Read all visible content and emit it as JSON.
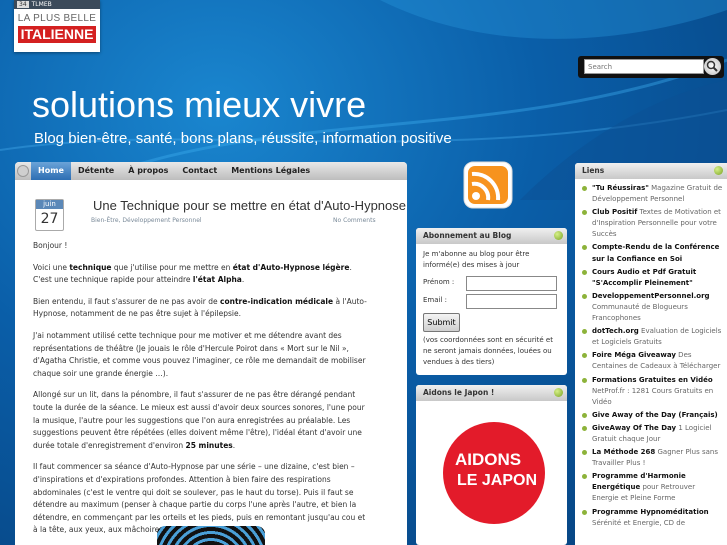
{
  "banner": {
    "strip_left": "34",
    "strip_right": "TLMEB",
    "line1": "LA PLUS BELLE",
    "line2": "ITALIENNE"
  },
  "search": {
    "placeholder": "Search"
  },
  "site": {
    "title": "solutions mieux vivre",
    "tagline": "Blog bien-être, santé, bons plans, réussite, information positive"
  },
  "nav": [
    "Home",
    "Détente",
    "À propos",
    "Contact",
    "Mentions Légales"
  ],
  "post": {
    "month": "juin",
    "day": "27",
    "title": "Une Technique pour se mettre en état d'Auto-Hypnose",
    "meta": "Bien-Être, Développement Personnel",
    "comments": "No Comments",
    "paragraphs": [
      "Bonjour !",
      "Voici une <b>technique</b> que j'utilise pour me mettre en <b>état d'Auto-Hypnose légère</b>. C'est une technique rapide pour atteindre <b>l'état Alpha</b>.",
      "Bien entendu, il faut s'assurer de ne pas avoir de <b>contre-indication médicale</b> à l'Auto-Hypnose, notamment de ne pas être sujet à l'épilepsie.",
      "J'ai notamment utilisé cette technique pour me motiver et me détendre avant des représentations de théâtre (Je jouais le rôle d'Hercule Poirot dans « Mort sur le Nil », d'Agatha Christie, et comme vous pouvez l'imaginer, ce rôle me demandait de mobiliser chaque soir une grande énergie …).",
      "Allongé sur un lit, dans la pénombre, il faut s'assurer de ne pas être dérangé pendant toute la durée de la séance. Le mieux est aussi d'avoir deux sources sonores, l'une pour la musique, l'autre pour les suggestions que l'on aura enregistrées au préalable. Les suggestions peuvent être répétées (elles doivent même l'être), l'idéal étant d'avoir une durée totale d'enregistrement d'environ <b>25 minutes</b>.",
      "Il faut commencer sa séance d'Auto-Hypnose par une série – une dizaine, c'est bien – d'inspirations et d'expirations profondes. Attention à bien faire des respirations abdominales (c'est le ventre qui doit se soulever, pas le haut du torse). Puis il faut se détendre au maximum (penser à chaque partie du corps l'une après l'autre, et bien la détendre, en commençant par les orteils et les pieds, puis en remontant jusqu'au cou et à la tête, aux yeux, aux mâchoires …)."
    ]
  },
  "abonnement": {
    "title": "Abonnement au Blog",
    "intro": "Je m'abonne au blog pour être informé(e) des mises à jour",
    "prenom_label": "Prénom :",
    "email_label": "Email :",
    "submit": "Submit",
    "fine": "(vos coordonnées sont en sécurité et ne seront jamais données, louées ou vendues à des tiers)"
  },
  "aidons": {
    "title": "Aidons le Japon !",
    "logo_line1": "AIDONS",
    "logo_line2": "LE JAPON"
  },
  "liens": {
    "title": "Liens",
    "items": [
      {
        "name": "\"Tu Réussiras\"",
        "desc": " Magazine Gratuit de Développement Personnel"
      },
      {
        "name": "Club Positif",
        "desc": " Textes de Motivation et d'Inspiration Personnelle pour votre Succès"
      },
      {
        "name": "Compte-Rendu de la Conférence sur la Confiance en Soi",
        "desc": ""
      },
      {
        "name": "Cours Audio et Pdf Gratuit \"S'Accomplir Pleinement\"",
        "desc": ""
      },
      {
        "name": "DeveloppementPersonnel.org",
        "desc": " Communauté de Blogueurs Francophones"
      },
      {
        "name": "dotTech.org",
        "desc": " Evaluation de Logiciels et Logiciels Gratuits"
      },
      {
        "name": "Foire Méga Giveaway",
        "desc": " Des Centaines de Cadeaux à Télécharger"
      },
      {
        "name": "Formations Gratuites en Vidéo",
        "desc": " NetProf.fr : 1281 Cours Gratuits en Vidéo"
      },
      {
        "name": "Give Away of the Day (Français)",
        "desc": ""
      },
      {
        "name": "GiveAway Of The Day",
        "desc": " 1 Logiciel Gratuit chaque Jour"
      },
      {
        "name": "La Méthode 268",
        "desc": " Gagner Plus sans Travailler Plus !"
      },
      {
        "name": "Programme d'Harmonie Energétique",
        "desc": " pour Retrouver Energie et Pleine Forme"
      },
      {
        "name": "Programme Hypnoméditation",
        "desc": " Sérénité et Energie, CD de"
      }
    ]
  }
}
